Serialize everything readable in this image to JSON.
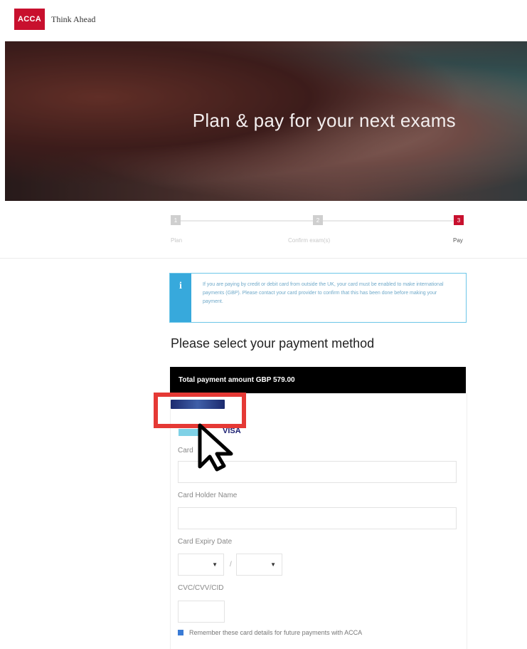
{
  "header": {
    "logo_text": "ACCA",
    "tagline": "Think Ahead"
  },
  "hero": {
    "title": "Plan & pay for your next exams"
  },
  "stepper": {
    "steps": [
      {
        "number": "1",
        "label": "Plan",
        "state": "done"
      },
      {
        "number": "2",
        "label": "Confirm exam(s)",
        "state": "done"
      },
      {
        "number": "3",
        "label": "Pay",
        "state": "active"
      }
    ]
  },
  "info": {
    "icon": "info-icon",
    "text": "If you are paying by credit or debit card from outside the UK, your card must be enabled to make international payments (GBP). Please contact your card provider to confirm that this has been done before making your payment."
  },
  "payment": {
    "heading": "Please select your payment method",
    "total_label": "Total payment amount GBP 579.00",
    "card_brand": "VISA",
    "fields": {
      "card_number_label": "Card",
      "card_holder_label": "Card Holder Name",
      "expiry_label": "Card Expiry Date",
      "expiry_separator": "/",
      "cvc_label": "CVC/CVV/CID"
    },
    "remember_label": "Remember these card details for future payments with ACCA"
  },
  "colors": {
    "brand": "#c8102e",
    "info_accent": "#37a9dc",
    "highlight": "#e53935"
  }
}
